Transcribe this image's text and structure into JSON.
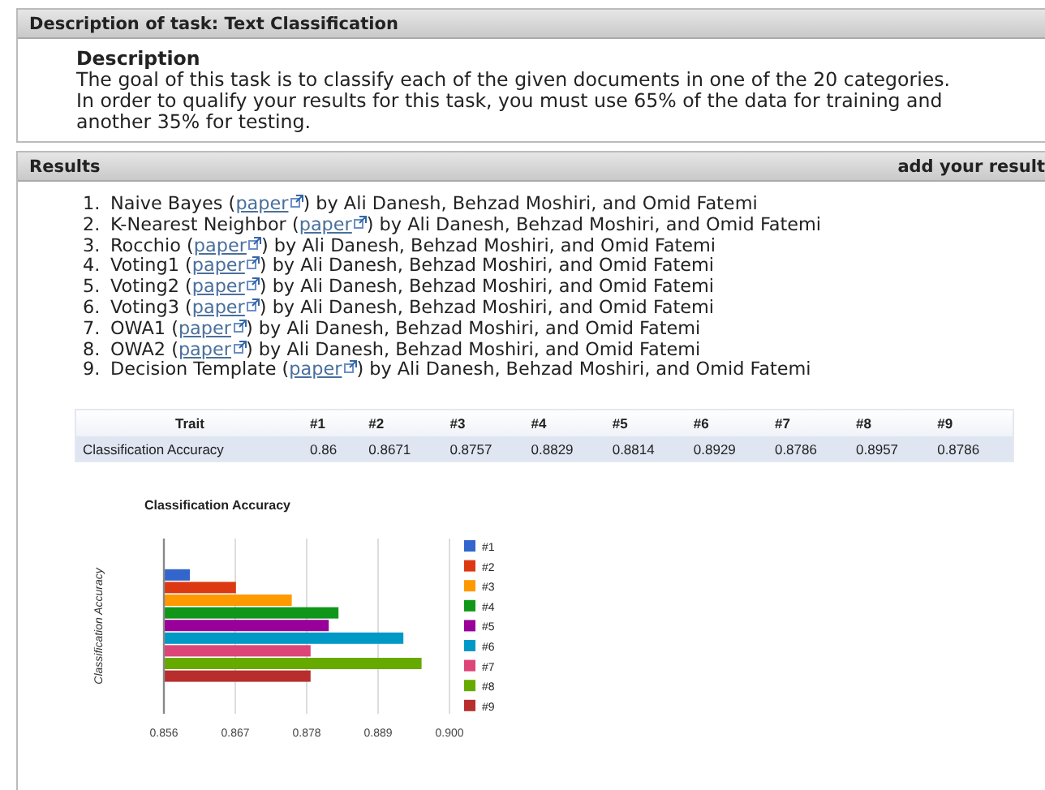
{
  "task_panel": {
    "title": "Description of task: Text Classification",
    "description_heading": "Description",
    "description": [
      "The goal of this task is to classify each of the given documents in one of the 20 categories.",
      "In order to qualify your results for this task, you must use 65% of the data for training and another 35% for testing."
    ]
  },
  "results_panel": {
    "title": "Results",
    "add_link": "add your result",
    "items": [
      {
        "number": "1.",
        "name": "Naive Bayes (",
        "link": "paper",
        "authors": ") by Ali Danesh, Behzad Moshiri, and Omid Fatemi"
      },
      {
        "number": "2.",
        "name": "K-Nearest Neighbor (",
        "link": "paper",
        "authors": ") by Ali Danesh, Behzad Moshiri, and Omid Fatemi"
      },
      {
        "number": "3.",
        "name": "Rocchio (",
        "link": "paper",
        "authors": ") by Ali Danesh, Behzad Moshiri, and Omid Fatemi"
      },
      {
        "number": "4.",
        "name": "Voting1 (",
        "link": "paper",
        "authors": ") by Ali Danesh, Behzad Moshiri, and Omid Fatemi"
      },
      {
        "number": "5.",
        "name": "Voting2 (",
        "link": "paper",
        "authors": ") by Ali Danesh, Behzad Moshiri, and Omid Fatemi"
      },
      {
        "number": "6.",
        "name": "Voting3 (",
        "link": "paper",
        "authors": ") by Ali Danesh, Behzad Moshiri, and Omid Fatemi"
      },
      {
        "number": "7.",
        "name": "OWA1 (",
        "link": "paper",
        "authors": ") by Ali Danesh, Behzad Moshiri, and Omid Fatemi"
      },
      {
        "number": "8.",
        "name": "OWA2 (",
        "link": "paper",
        "authors": ") by Ali Danesh, Behzad Moshiri, and Omid Fatemi"
      },
      {
        "number": "9.",
        "name": "Decision Template (",
        "link": "paper",
        "authors": ") by Ali Danesh, Behzad Moshiri, and Omid Fatemi"
      }
    ],
    "table": {
      "columns": [
        "Trait",
        "#1",
        "#2",
        "#3",
        "#4",
        "#5",
        "#6",
        "#7",
        "#8",
        "#9"
      ],
      "rows": [
        [
          "Classification Accuracy",
          "0.86",
          "0.8671",
          "0.8757",
          "0.8829",
          "0.8814",
          "0.8929",
          "0.8786",
          "0.8957",
          "0.8786"
        ]
      ]
    },
    "chart_data": {
      "type": "bar",
      "orientation": "horizontal",
      "title": "Classification Accuracy",
      "ylabel": "Classification Accuracy",
      "grid": true,
      "legend": true,
      "xlim": [
        0.856,
        0.9
      ],
      "xticks": [
        {
          "value": 0.856,
          "label": "0.856"
        },
        {
          "value": 0.867,
          "label": "0.867"
        },
        {
          "value": 0.878,
          "label": "0.878"
        },
        {
          "value": 0.889,
          "label": "0.889"
        },
        {
          "value": 0.9,
          "label": "0.900"
        }
      ],
      "series": [
        {
          "name": "#1",
          "color": "#3366cc",
          "values": [
            0.86
          ]
        },
        {
          "name": "#2",
          "color": "#dc3912",
          "values": [
            0.8671
          ]
        },
        {
          "name": "#3",
          "color": "#ff9900",
          "values": [
            0.8757
          ]
        },
        {
          "name": "#4",
          "color": "#109618",
          "values": [
            0.8829
          ]
        },
        {
          "name": "#5",
          "color": "#990099",
          "values": [
            0.8814
          ]
        },
        {
          "name": "#6",
          "color": "#0099c6",
          "values": [
            0.8929
          ]
        },
        {
          "name": "#7",
          "color": "#dd4477",
          "values": [
            0.8786
          ]
        },
        {
          "name": "#8",
          "color": "#66aa00",
          "values": [
            0.8957
          ]
        },
        {
          "name": "#9",
          "color": "#b82e2e",
          "values": [
            0.8786
          ]
        }
      ]
    }
  }
}
